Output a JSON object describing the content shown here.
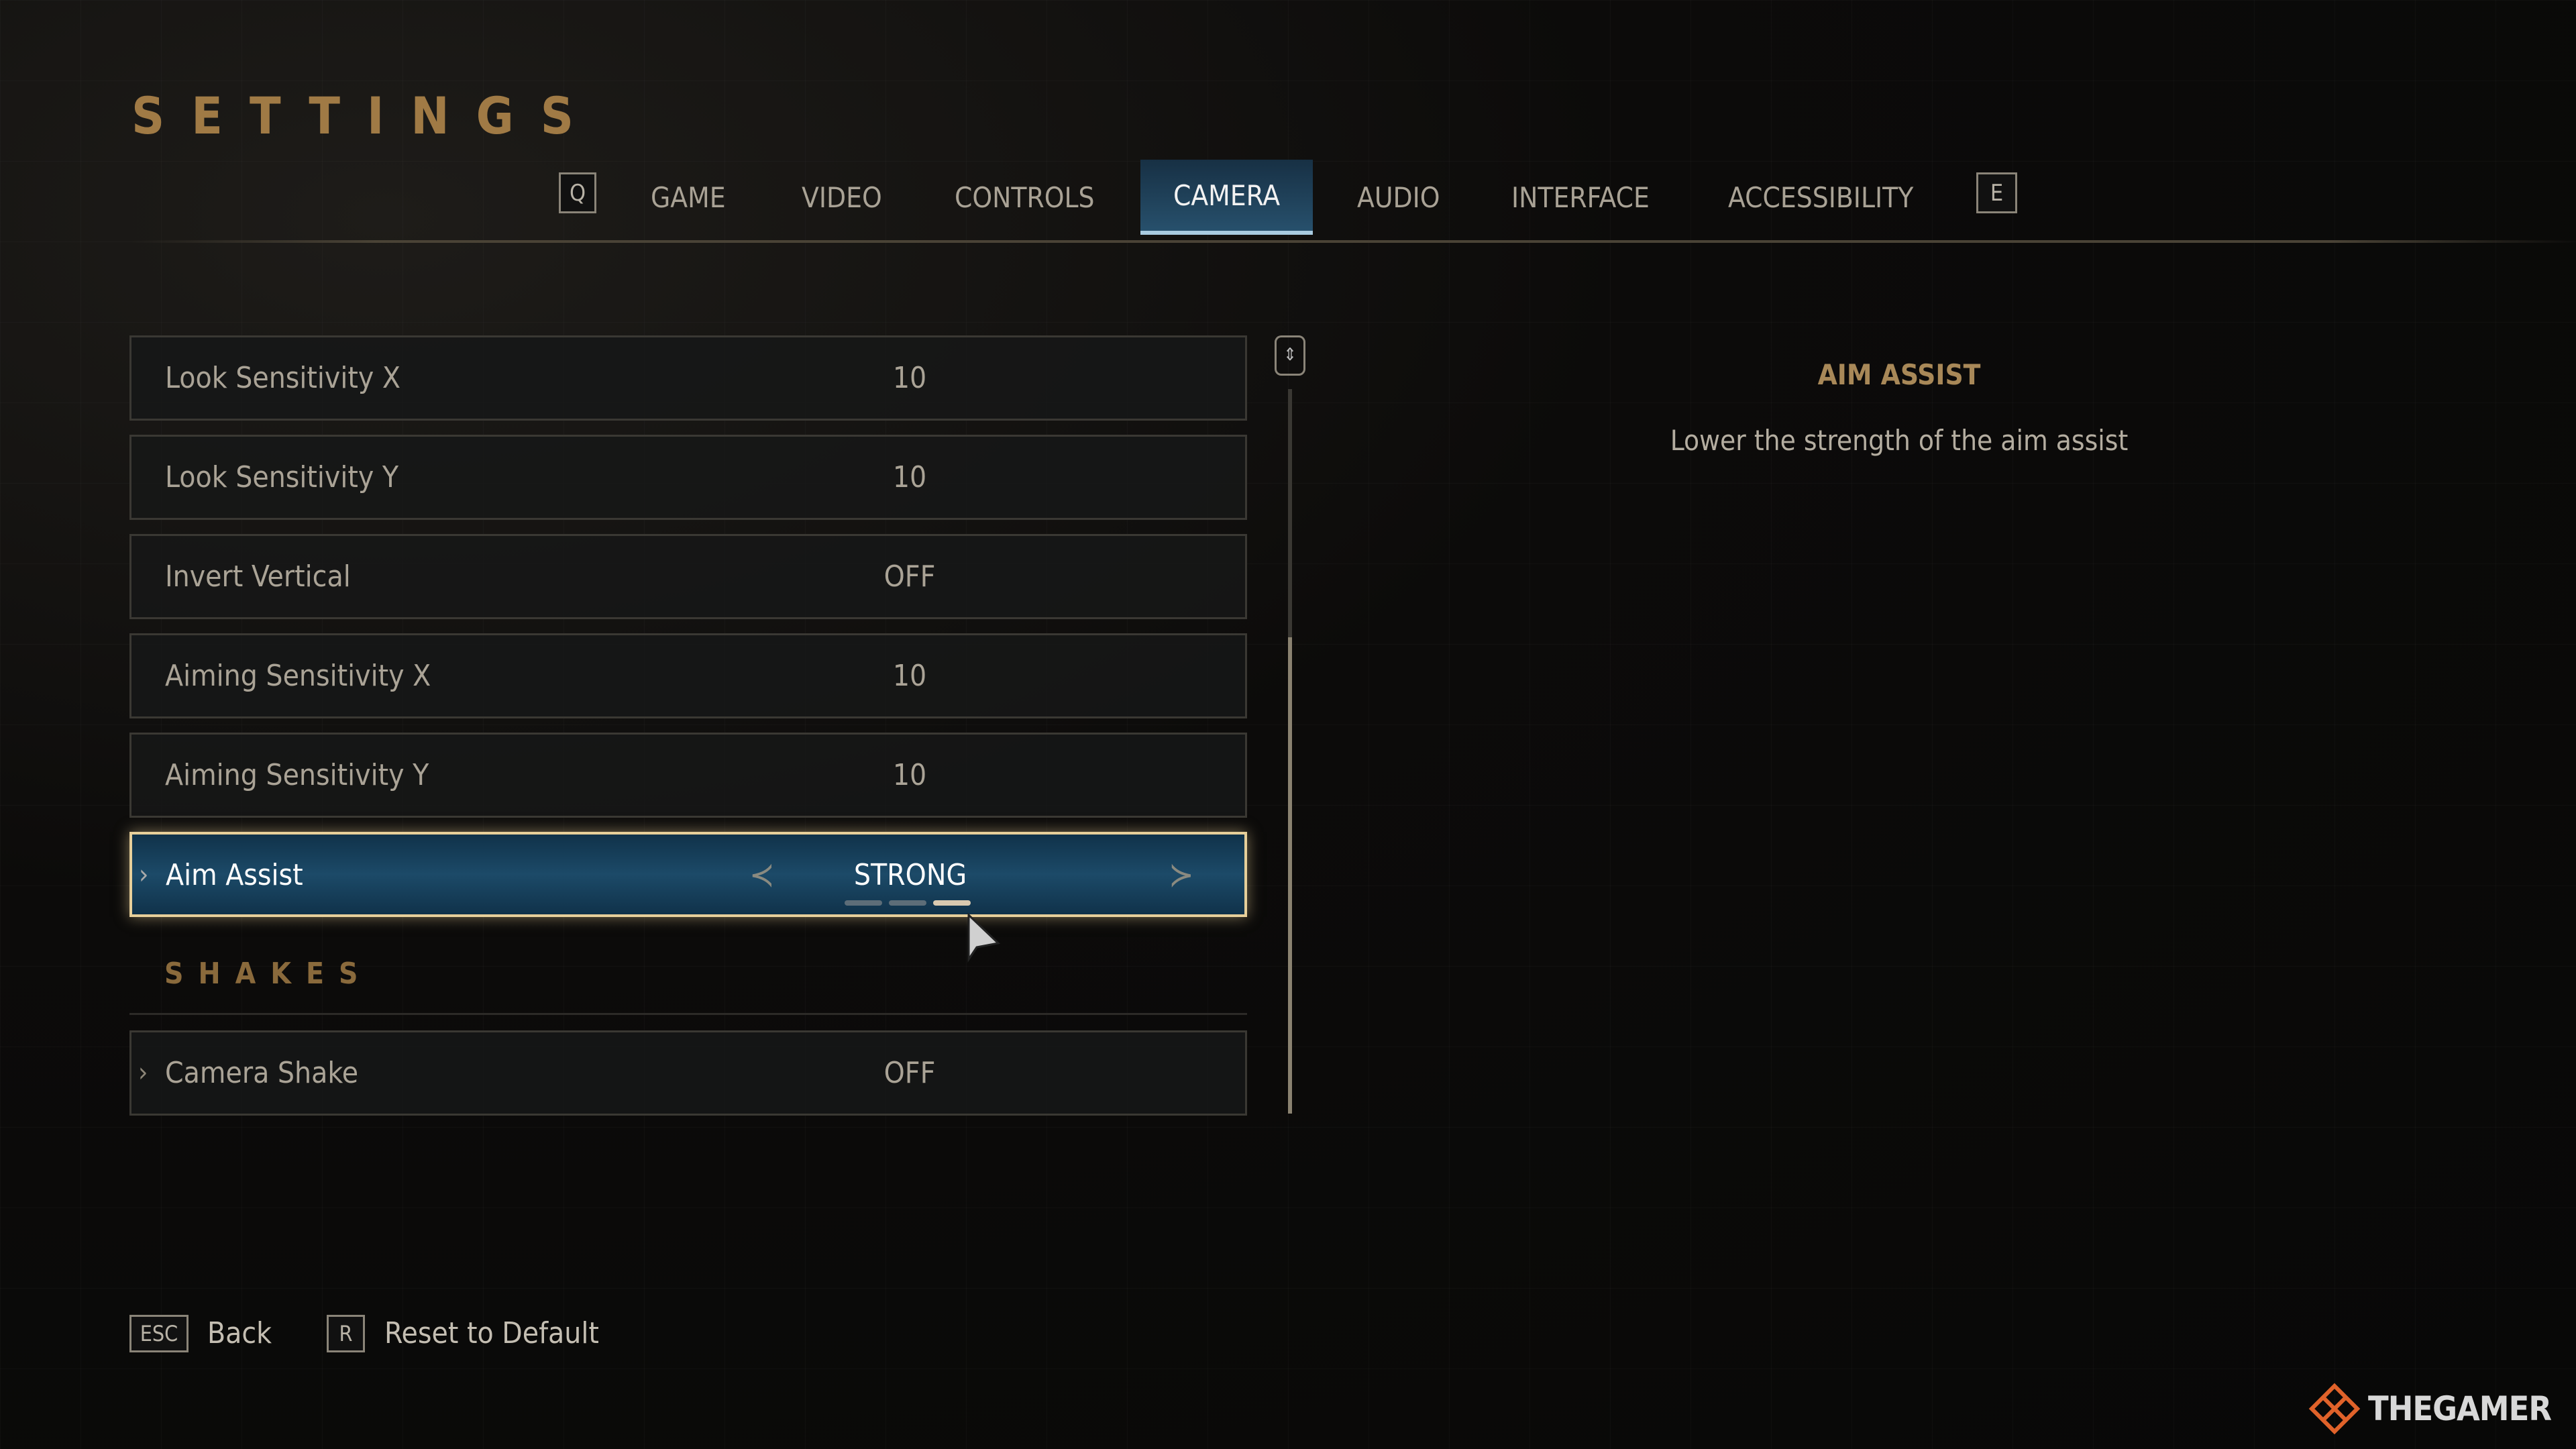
{
  "title": "SETTINGS",
  "tabs": {
    "prev_key": "Q",
    "next_key": "E",
    "items": [
      {
        "label": "GAME"
      },
      {
        "label": "VIDEO"
      },
      {
        "label": "CONTROLS"
      },
      {
        "label": "CAMERA",
        "active": true
      },
      {
        "label": "AUDIO"
      },
      {
        "label": "INTERFACE"
      },
      {
        "label": "ACCESSIBILITY"
      }
    ]
  },
  "settings": [
    {
      "label": "Look Sensitivity X",
      "value": "10"
    },
    {
      "label": "Look Sensitivity Y",
      "value": "10"
    },
    {
      "label": "Invert Vertical",
      "value": "OFF"
    },
    {
      "label": "Aiming Sensitivity X",
      "value": "10"
    },
    {
      "label": "Aiming Sensitivity Y",
      "value": "10"
    },
    {
      "label": "Aim Assist",
      "value": "STRONG",
      "selected": true,
      "option_index": 3,
      "option_count": 3
    }
  ],
  "shakes": {
    "header": "SHAKES",
    "items": [
      {
        "label": "Camera Shake",
        "value": "OFF"
      }
    ]
  },
  "detail": {
    "title": "AIM ASSIST",
    "description": "Lower the strength of the aim assist"
  },
  "footer": {
    "back_key": "ESC",
    "back_label": "Back",
    "reset_key": "R",
    "reset_label": "Reset to Default"
  },
  "watermark": "THEGAMER",
  "colors": {
    "accent_gold": "#a07a45",
    "selected_blue": "#1c4a68",
    "selected_border": "#e7cf9a"
  }
}
